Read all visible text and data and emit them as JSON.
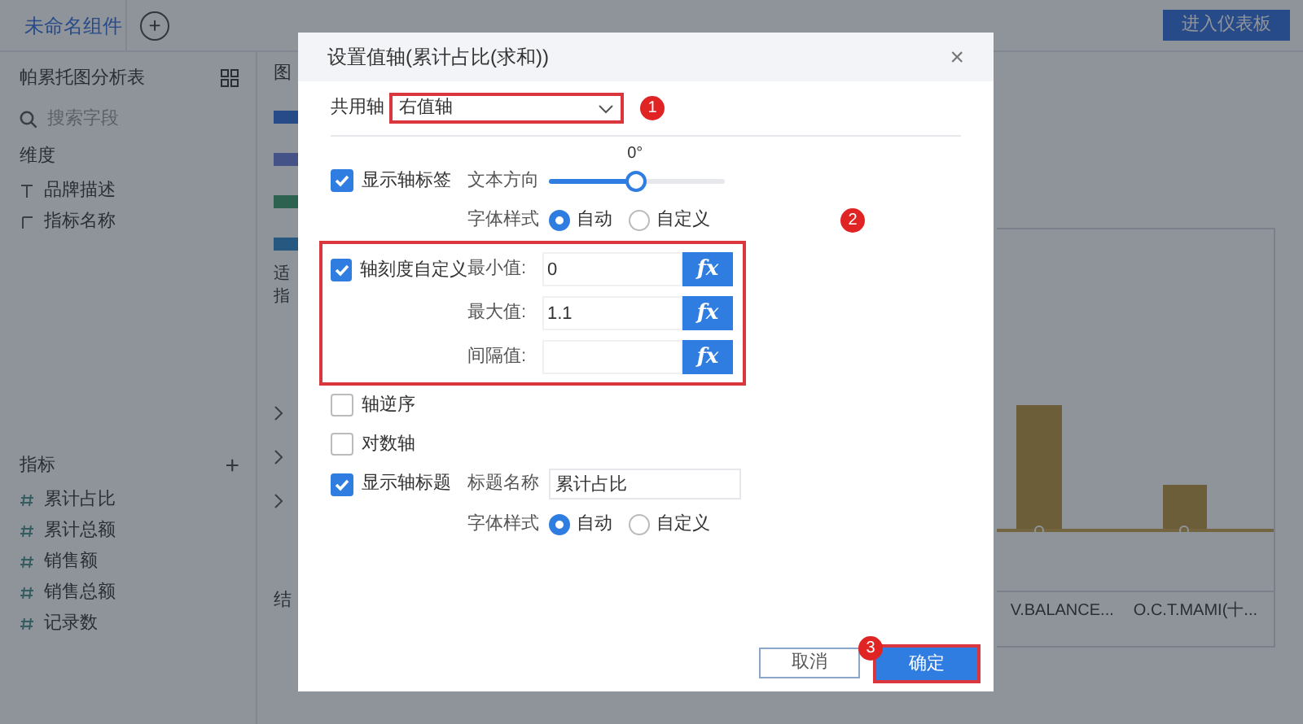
{
  "top_bar": {
    "component_tab": "未命名组件",
    "add_button": "+",
    "dashboard_button": "进入仪表板"
  },
  "left_panel": {
    "title": "帕累托图分析表",
    "search": {
      "placeholder": "搜索字段"
    },
    "dimensions": {
      "title": "维度",
      "items": [
        {
          "label": "品牌描述",
          "kind": "text"
        },
        {
          "label": "指标名称",
          "kind": "tree"
        }
      ]
    },
    "measures": {
      "title": "指标",
      "add_button": "+",
      "items": [
        {
          "label": "累计占比"
        },
        {
          "label": "累计总额"
        },
        {
          "label": "销售额"
        },
        {
          "label": "销售总额"
        },
        {
          "label": "记录数"
        }
      ]
    }
  },
  "middle_column": {
    "title": "图",
    "hint_lines": [
      "适",
      "指"
    ],
    "footer": "结"
  },
  "chart": {
    "x_labels": [
      "V.BALANCE...",
      "O.C.T.MAMI(十..."
    ]
  },
  "dialog": {
    "title": "设置值轴(累计占比(求和))",
    "close": "×",
    "shared_axis": {
      "label": "共用轴",
      "value": "右值轴"
    },
    "show_axis_labels": {
      "label": "显示轴标签",
      "checked": true,
      "text_direction": {
        "label": "文本方向",
        "reading": "0°",
        "level": 0.49
      },
      "font_style": {
        "label": "字体样式",
        "options": [
          {
            "label": "自动",
            "selected": true
          },
          {
            "label": "自定义",
            "selected": false
          }
        ]
      }
    },
    "custom_scale": {
      "label": "轴刻度自定义",
      "checked": true,
      "fields": [
        {
          "label": "最小值:",
          "value": "0",
          "button": "fx"
        },
        {
          "label": "最大值:",
          "value": "1.1",
          "button": "fx"
        },
        {
          "label": "间隔值:",
          "button": "fx"
        }
      ]
    },
    "reverse_axis": {
      "label": "轴逆序",
      "checked": false
    },
    "log_axis": {
      "label": "对数轴",
      "checked": false
    },
    "show_axis_title": {
      "label": "显示轴标题",
      "checked": true,
      "title_name": {
        "label": "标题名称",
        "value": "累计占比"
      },
      "font_style": {
        "label": "字体样式",
        "options": [
          {
            "label": "自动",
            "selected": true
          },
          {
            "label": "自定义",
            "selected": false
          }
        ]
      }
    },
    "buttons": {
      "cancel": "取消",
      "confirm": "确定"
    },
    "step_badges": [
      "1",
      "2",
      "3"
    ]
  }
}
